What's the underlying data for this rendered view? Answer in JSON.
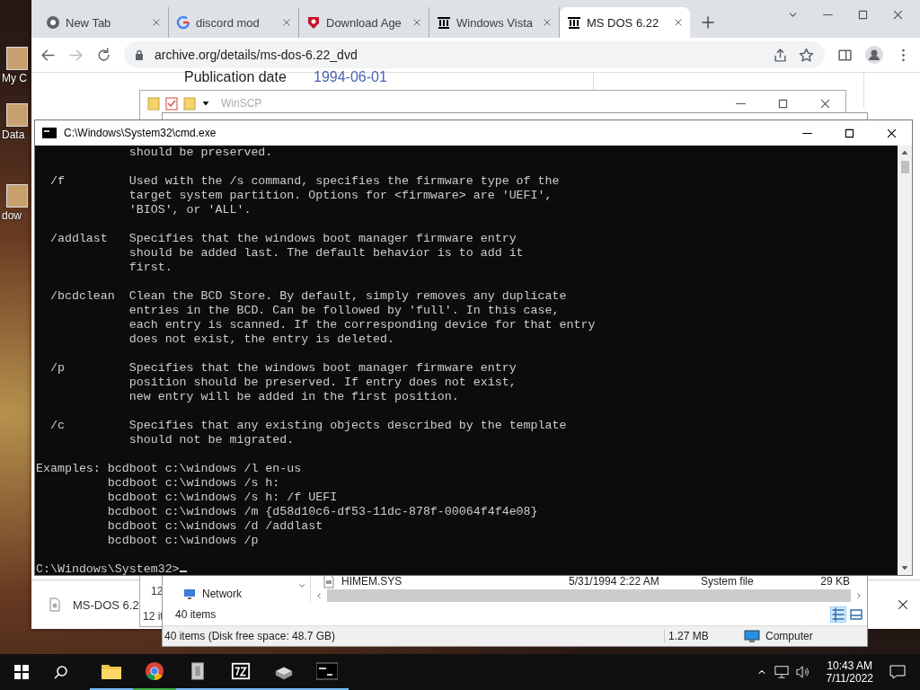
{
  "desktop": {
    "icons": [
      {
        "label": "My C"
      },
      {
        "label": "Data"
      },
      {
        "label": "dow"
      }
    ]
  },
  "browser": {
    "tabs": [
      {
        "title": "New Tab",
        "selected": false
      },
      {
        "title": "discord mod",
        "selected": false
      },
      {
        "title": "Download Age",
        "selected": false
      },
      {
        "title": "Windows Vista",
        "selected": false
      },
      {
        "title": "MS DOS 6.22",
        "selected": true
      }
    ],
    "address": "archive.org/details/ms-dos-6.22_dvd",
    "page": {
      "field_label": "Publication date",
      "field_value": "1994-06-01"
    },
    "download_bar": {
      "file": "MS-DOS 6.2"
    }
  },
  "winscp": {
    "title": "WinSCP",
    "count": "12",
    "status": "12 it"
  },
  "explorer": {
    "nav": [
      "Network"
    ],
    "file": {
      "name": "HIMEM.SYS",
      "date": "5/31/1994 2:22 AM",
      "type": "System file",
      "size": "29 KB"
    },
    "items": "40 items",
    "status": "40 items (Disk free space: 48.7 GB)",
    "size": "1.27 MB",
    "location": "Computer"
  },
  "cmd": {
    "title": "C:\\Windows\\System32\\cmd.exe",
    "blocks": [
      [
        "             should be preserved."
      ],
      [
        "  /f         Used with the /s command, specifies the firmware type of the",
        "             target system partition. Options for <firmware> are 'UEFI',",
        "             'BIOS', or 'ALL'."
      ],
      [
        "  /addlast   Specifies that the windows boot manager firmware entry",
        "             should be added last. The default behavior is to add it",
        "             first."
      ],
      [
        "  /bcdclean  Clean the BCD Store. By default, simply removes any duplicate",
        "             entries in the BCD. Can be followed by 'full'. In this case,",
        "             each entry is scanned. If the corresponding device for that entry",
        "             does not exist, the entry is deleted."
      ],
      [
        "  /p         Specifies that the windows boot manager firmware entry",
        "             position should be preserved. If entry does not exist,",
        "             new entry will be added in the first position."
      ],
      [
        "  /c         Specifies that any existing objects described by the template",
        "             should not be migrated."
      ],
      [
        "Examples: bcdboot c:\\windows /l en-us",
        "          bcdboot c:\\windows /s h:",
        "          bcdboot c:\\windows /s h: /f UEFI",
        "          bcdboot c:\\windows /m {d58d10c6-df53-11dc-878f-00064f4f4e08}",
        "          bcdboot c:\\windows /d /addlast",
        "          bcdboot c:\\windows /p"
      ]
    ],
    "prompt": "C:\\Windows\\System32>"
  },
  "taskbar": {
    "time": "10:43 AM",
    "date": "7/11/2022"
  }
}
